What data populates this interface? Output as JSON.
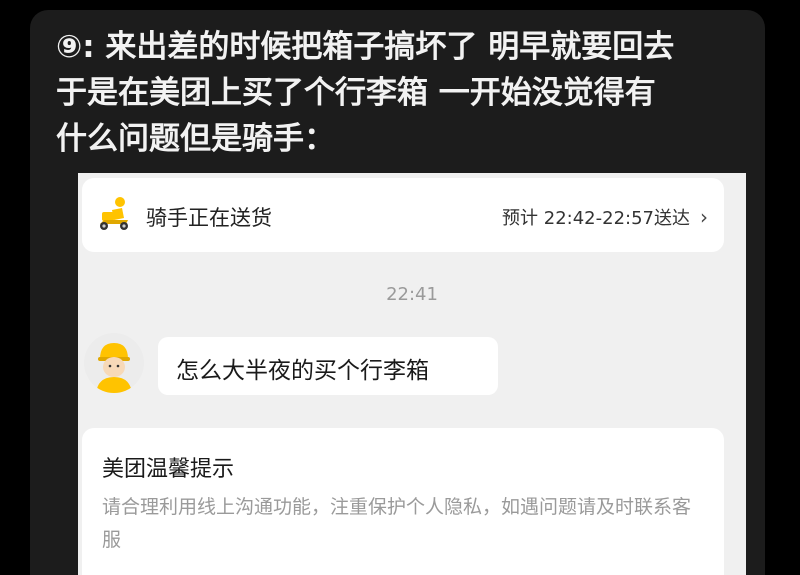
{
  "post": {
    "lines": [
      "⑨: 来出差的时候把箱子搞坏了 明早就要回去",
      "于是在美团上买了个行李箱 一开始没觉得有",
      "什么问题但是骑手："
    ]
  },
  "delivery_status": {
    "icon": "rider-scooter-icon",
    "label": "骑手正在送货",
    "eta": "预计 22:42-22:57送达",
    "chevron": "›"
  },
  "chat": {
    "time": "22:41",
    "avatar_icon": "rider-avatar-icon",
    "message": "怎么大半夜的买个行李箱"
  },
  "tip": {
    "title": "美团温馨提示",
    "body": "请合理利用线上沟通功能，注重保护个人隐私，如遇问题请及时联系客服"
  },
  "colors": {
    "page_bg": "#000000",
    "card_bg": "#1c1c1c",
    "post_text": "#f2f2f2",
    "app_bg": "#f0f0f0",
    "meituan_yellow": "#ffc300",
    "muted_text": "#9a9a9a"
  }
}
